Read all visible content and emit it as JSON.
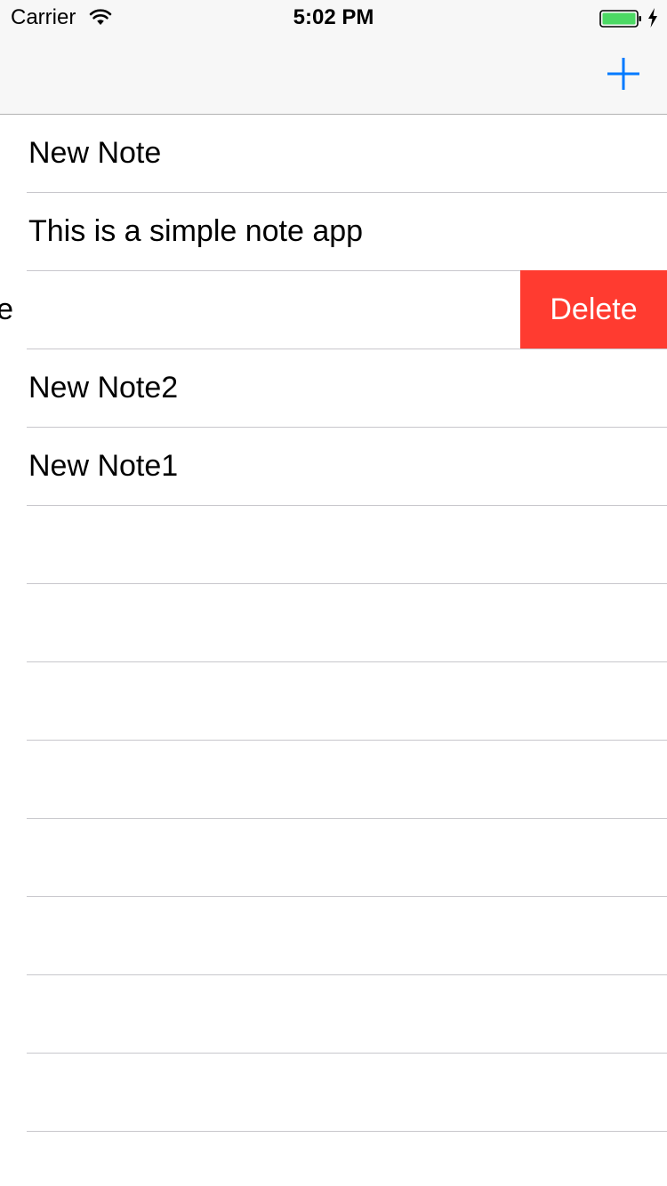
{
  "status_bar": {
    "carrier": "Carrier",
    "time": "5:02 PM",
    "icons": [
      "wifi-icon",
      "battery-icon",
      "charging-icon"
    ],
    "battery_color": "#4cd964"
  },
  "nav_bar": {
    "add_icon": "plus-icon",
    "accent_color": "#007aff"
  },
  "notes": [
    {
      "title": "New Note"
    },
    {
      "title": "This is a simple note app"
    },
    {
      "title": "e",
      "swiped": true,
      "delete_label": "Delete"
    },
    {
      "title": "New Note2"
    },
    {
      "title": "New Note1"
    },
    {
      "title": ""
    },
    {
      "title": ""
    },
    {
      "title": ""
    },
    {
      "title": ""
    },
    {
      "title": ""
    },
    {
      "title": ""
    },
    {
      "title": ""
    },
    {
      "title": ""
    }
  ],
  "colors": {
    "delete": "#ff3b30",
    "separator": "#c8c7cc",
    "bar_background": "#f7f7f7"
  }
}
